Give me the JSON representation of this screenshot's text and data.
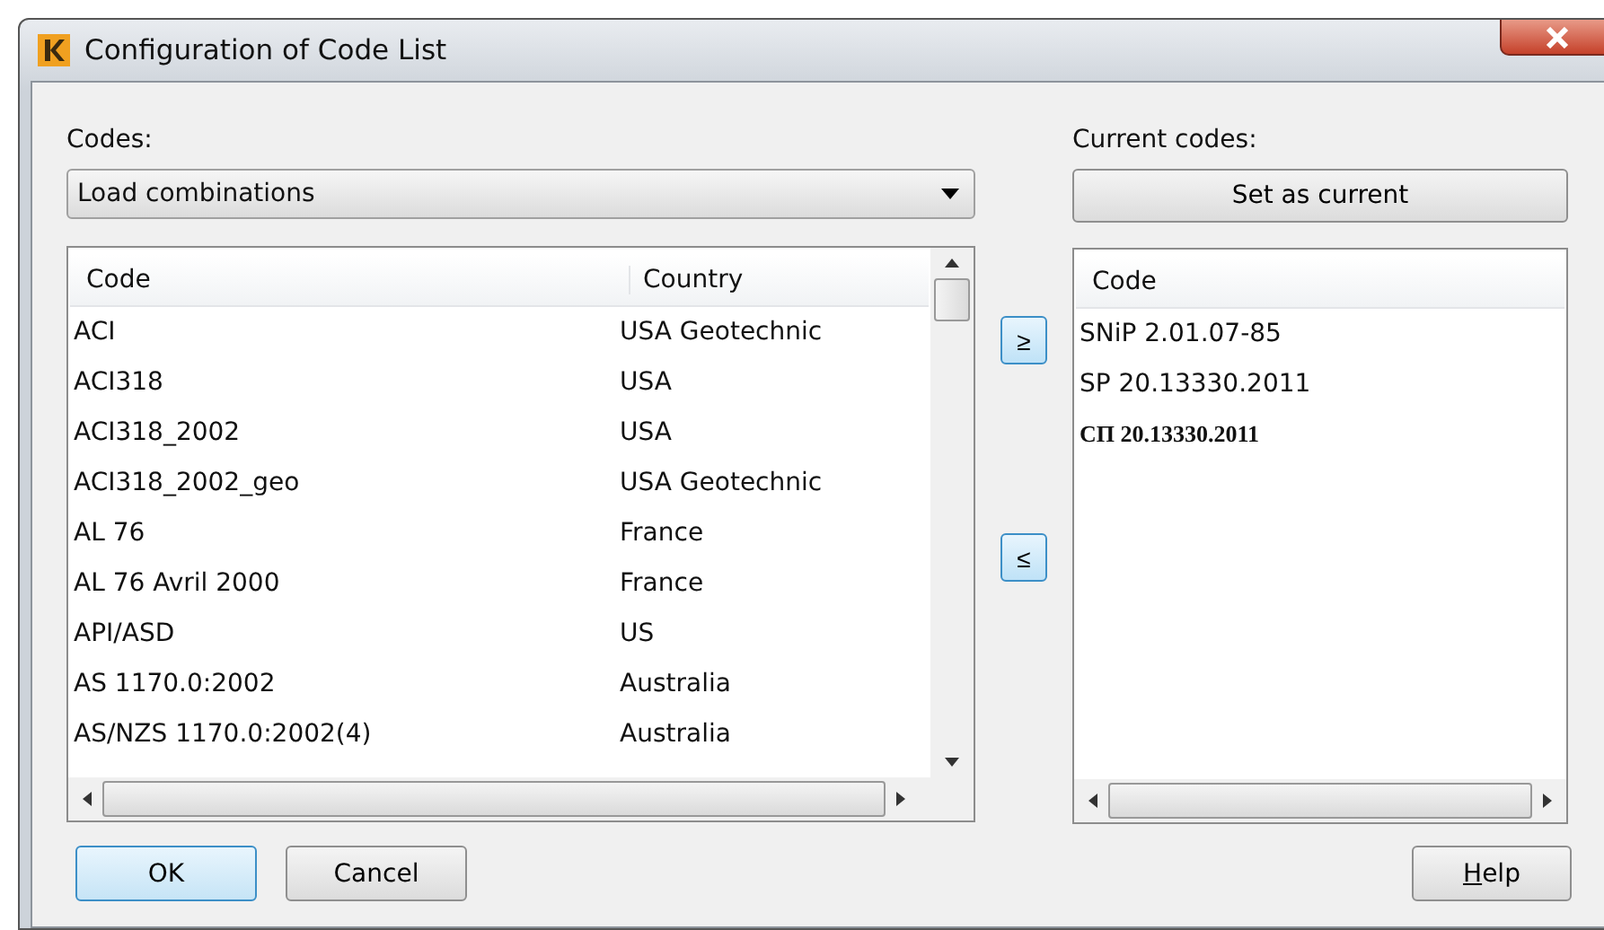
{
  "window": {
    "title": "Configuration of Code List"
  },
  "codes": {
    "label": "Codes:",
    "dropdown": "Load combinations"
  },
  "code_table": {
    "columns": [
      "Code",
      "Country"
    ],
    "rows": [
      {
        "code": "ACI",
        "country": "USA Geotechnic"
      },
      {
        "code": "ACI318",
        "country": "USA"
      },
      {
        "code": "ACI318_2002",
        "country": "USA"
      },
      {
        "code": "ACI318_2002_geo",
        "country": "USA Geotechnic"
      },
      {
        "code": "AL 76",
        "country": "France"
      },
      {
        "code": "AL 76 Avril 2000",
        "country": "France"
      },
      {
        "code": "API/ASD",
        "country": "US"
      },
      {
        "code": "AS 1170.0:2002",
        "country": "Australia"
      },
      {
        "code": "AS/NZS 1170.0:2002(4)",
        "country": " Australia"
      }
    ]
  },
  "move_buttons": [
    "≥",
    "≤"
  ],
  "current": {
    "label": "Current codes:",
    "set_button": "Set as current",
    "column": "Code",
    "rows": [
      {
        "code": "SNiP 2.01.07-85",
        "bold": false
      },
      {
        "code": "SP 20.13330.2011",
        "bold": false
      },
      {
        "code": "СП 20.13330.2011",
        "bold": true
      }
    ]
  },
  "buttons": [
    {
      "label": "OK",
      "default": true,
      "mnemonic": false
    },
    {
      "label": "Cancel",
      "default": false,
      "mnemonic": false
    },
    {
      "label": "Help",
      "default": false,
      "mnemonic": true
    }
  ]
}
